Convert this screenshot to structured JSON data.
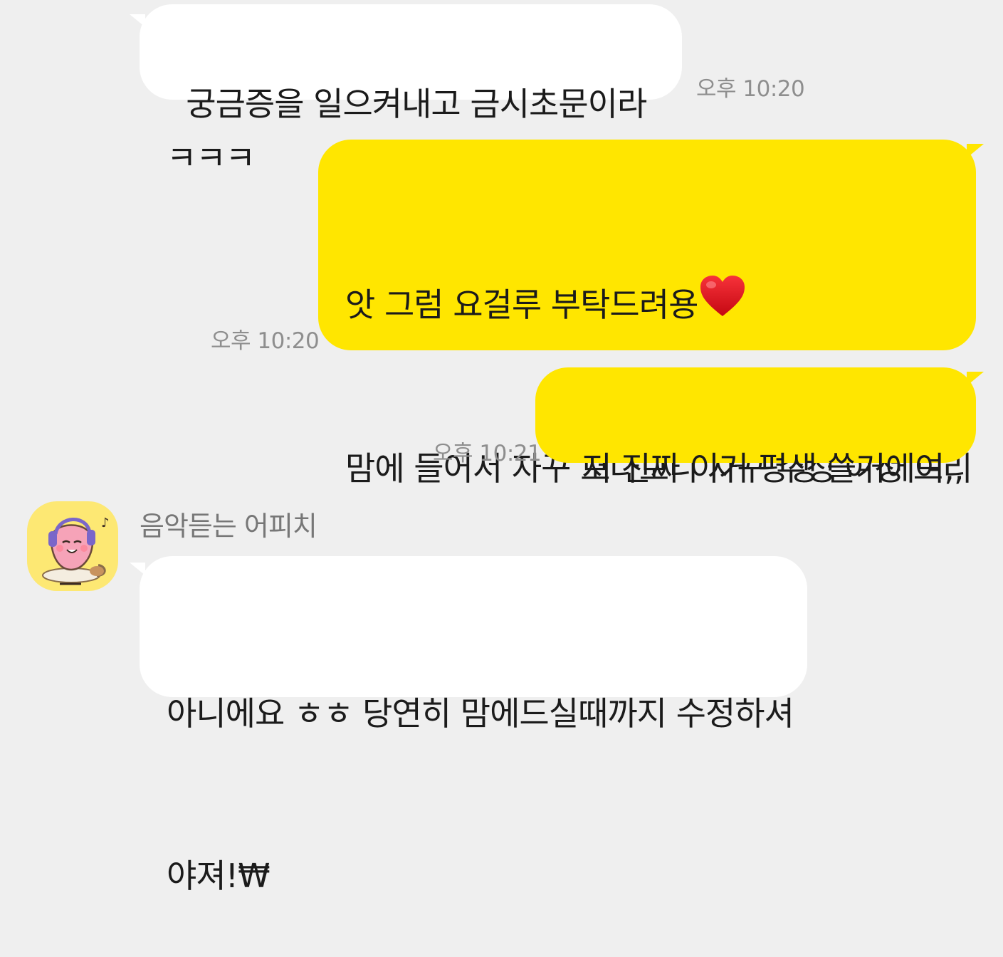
{
  "messages": [
    {
      "side": "received",
      "text": "궁금증을 일으켜내고 금시초문이라 ㅋㅋㅋ",
      "time": "오후 10:20"
    },
    {
      "side": "sent",
      "line1": "앗 그럼 요걸루 부탁드려용",
      "line2": "맘에 들어서 자꾸 보다보니 자꾸 수정 여청 드리",
      "line3": "네요,,",
      "emoji": "red-heart",
      "time": "오후 10:20"
    },
    {
      "side": "sent",
      "text": "저 진짜 이거 평생 쓸거에여,,",
      "time": "오후 10:21"
    },
    {
      "side": "received",
      "sender": "음악듣는 어피치",
      "avatar": "apeach-headphones-profile",
      "line1": "아니에요 ㅎㅎ 당연히 맘에드실때까지 수정하셔",
      "line2": "야져!₩"
    }
  ],
  "colors": {
    "background": "#efefef",
    "sent_bubble": "#ffe600",
    "received_bubble": "#ffffff",
    "timestamp": "#8e8e8e",
    "heart": "#e0101a"
  }
}
